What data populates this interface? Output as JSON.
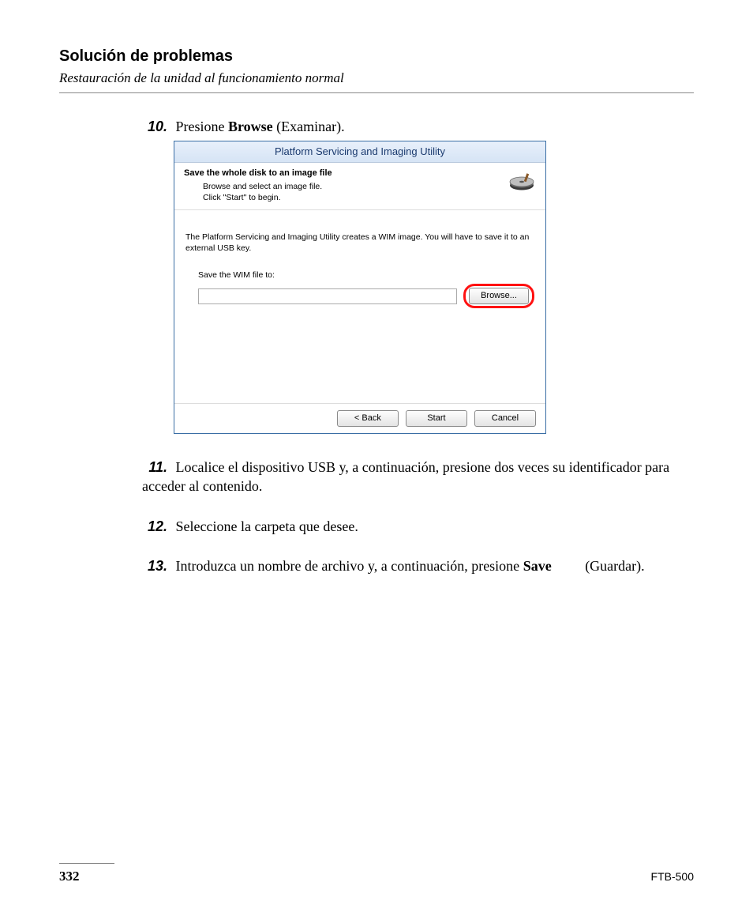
{
  "header": {
    "chapter": "Solución de problemas",
    "subtitle": "Restauración de la unidad al funcionamiento normal"
  },
  "steps": {
    "s10": {
      "num": "10.",
      "pre": "Presione ",
      "bold": "Browse",
      "post": " (Examinar)."
    },
    "s11": {
      "num": "11.",
      "text": "Localice el dispositivo USB y, a continuación, presione dos veces su identificador para acceder al contenido."
    },
    "s12": {
      "num": "12.",
      "text": "Seleccione la carpeta que desee."
    },
    "s13": {
      "num": "13.",
      "pre": "Introduzca un nombre de archivo y, a continuación, presione ",
      "bold": "Save",
      "post": " (Guardar)."
    }
  },
  "dialog": {
    "title": "Platform Servicing and Imaging Utility",
    "head_bold": "Save the whole disk to an image file",
    "head_line1": "Browse and select an image file.",
    "head_line2": "Click \"Start\" to begin.",
    "info": "The Platform Servicing and Imaging Utility creates a WIM image. You will have to save it to an external USB key.",
    "save_label": "Save the WIM file to:",
    "browse": "Browse...",
    "back": "< Back",
    "start": "Start",
    "cancel": "Cancel"
  },
  "footer": {
    "page": "332",
    "model": "FTB-500"
  }
}
